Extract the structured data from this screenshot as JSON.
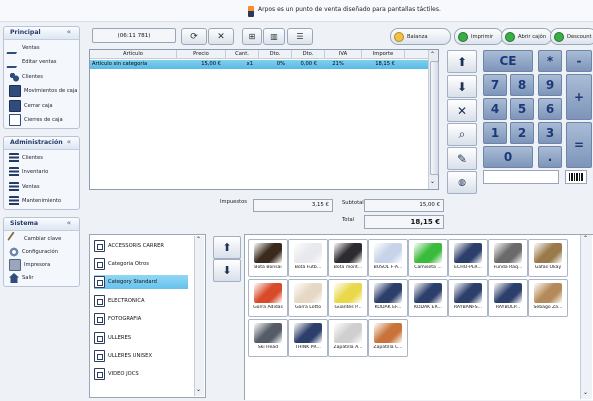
{
  "top_message": "Arpos es un punto de venta diseñado para pantallas táctiles.",
  "sidebar": {
    "panels": [
      {
        "title": "Principal",
        "toggle": "«",
        "items": [
          {
            "label": "Ventas",
            "icon": "cart-icon"
          },
          {
            "label": "Editar ventas",
            "icon": "edit-icon"
          },
          {
            "label": "Clientes",
            "icon": "users-icon"
          },
          {
            "label": "Movimientos de caja",
            "icon": "cash-movements-icon"
          },
          {
            "label": "Cerrar caja",
            "icon": "close-register-icon"
          },
          {
            "label": "Cierres de caja",
            "icon": "register-closures-icon"
          }
        ]
      },
      {
        "title": "Administración",
        "toggle": "«",
        "items": [
          {
            "label": "Clientes",
            "icon": "list-icon"
          },
          {
            "label": "Inventario",
            "icon": "list-icon"
          },
          {
            "label": "Ventas",
            "icon": "list-icon"
          },
          {
            "label": "Mantenimiento",
            "icon": "list-icon"
          }
        ]
      },
      {
        "title": "Sistema",
        "toggle": "«",
        "items": [
          {
            "label": "Cambiar clave",
            "icon": "pencil-icon"
          },
          {
            "label": "Configuración",
            "icon": "gear-icon"
          },
          {
            "label": "Impresora",
            "icon": "printer-icon"
          },
          {
            "label": "Salir",
            "icon": "home-exit-icon"
          }
        ]
      }
    ]
  },
  "toolbar": {
    "ticket_id": "(06:11 781)",
    "buttons": [
      "refresh-icon",
      "scissors-icon",
      "add-icon",
      "trash-icon",
      "list-icon"
    ],
    "actions": [
      {
        "label": "Balanza",
        "color": "#f0c14a"
      },
      {
        "label": "Imprimir",
        "color": "#3cab4a"
      },
      {
        "label": "Abrir cajón",
        "color": "#3cab4a"
      },
      {
        "label": "Descount",
        "color": "#3cab4a"
      }
    ]
  },
  "ticket": {
    "columns": [
      "Artículo",
      "Precio",
      "Cant.",
      "Dto.",
      "Dto.",
      "IVA",
      "Importe"
    ],
    "rows": [
      [
        "Artículo sin categoría",
        "15,00 €",
        "x1",
        "0%",
        "0,00 €",
        "21%",
        "18,15 €"
      ]
    ]
  },
  "totals": {
    "impuestos_label": "Impuestos",
    "impuestos": "3,15 €",
    "subtotal_label": "Subtotal",
    "subtotal": "15,00 €",
    "total_label": "Total",
    "total": "18,15 €"
  },
  "keypad": {
    "keys": [
      "CE",
      "*",
      "-",
      "7",
      "8",
      "9",
      "+",
      "4",
      "5",
      "6",
      "1",
      "2",
      "3",
      "=",
      "0",
      "."
    ]
  },
  "categories": [
    "ACCESSORIS CARRER",
    "Categoria Otros",
    "Category Standard",
    "ELECTRONICA",
    "FOTOGRAFIA",
    "ULLERES",
    "ULLERES UNISEX",
    "VIDEO JOCS"
  ],
  "selected_category": "Category Standard",
  "products": [
    {
      "label": "Bota Bonsai",
      "color": "#3a2a1c"
    },
    {
      "label": "Bota Futb...",
      "color": "#e8e8ef"
    },
    {
      "label": "Bota mont...",
      "color": "#2d2a30"
    },
    {
      "label": "BUSOL F-A...",
      "color": "#c7d3e8"
    },
    {
      "label": "Camiseta ...",
      "color": "#3bbb3b"
    },
    {
      "label": "ECHO-PLR...",
      "color": "#2c3f6b"
    },
    {
      "label": "Funda Raq...",
      "color": "#6a6a6a"
    },
    {
      "label": "Gafas Okay",
      "color": "#9a7a4a"
    },
    {
      "label": "Gorra Adidas",
      "color": "#d84a2a"
    },
    {
      "label": "Gorra Lotto",
      "color": "#e5d8c4"
    },
    {
      "label": "Guantes P...",
      "color": "#e8d84a"
    },
    {
      "label": "KODAK EF...",
      "color": "#2c3f6b"
    },
    {
      "label": "KODAK ER...",
      "color": "#2c3f6b"
    },
    {
      "label": "RAYBANFS...",
      "color": "#2c3f6b"
    },
    {
      "label": "RAYBOLP...",
      "color": "#2c3f6b"
    },
    {
      "label": "Sebago Za...",
      "color": "#b58a5a"
    },
    {
      "label": "Ski Head",
      "color": "#555c66"
    },
    {
      "label": "THINK PR...",
      "color": "#2c3f6b"
    },
    {
      "label": "Zapatilla A...",
      "color": "#cfcfcf"
    },
    {
      "label": "Zapatilla C...",
      "color": "#c9733a"
    }
  ]
}
